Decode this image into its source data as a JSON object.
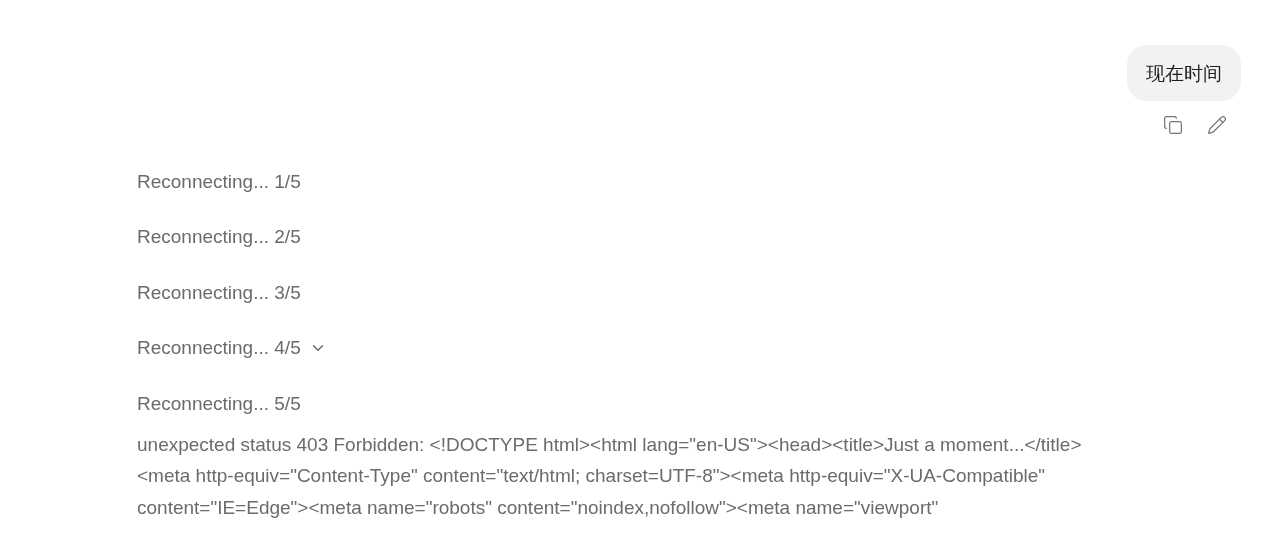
{
  "user_message": {
    "text": "现在时间"
  },
  "status_lines": [
    {
      "text": "Reconnecting... 1/5",
      "expandable": false
    },
    {
      "text": "Reconnecting... 2/5",
      "expandable": false
    },
    {
      "text": "Reconnecting... 3/5",
      "expandable": false
    },
    {
      "text": "Reconnecting... 4/5",
      "expandable": true
    },
    {
      "text": "Reconnecting... 5/5",
      "expandable": false
    }
  ],
  "error_lines": [
    "unexpected status 403 Forbidden: <!DOCTYPE html><html lang=\"en-US\"><head><title>Just a moment...</title>",
    "<meta http-equiv=\"Content-Type\" content=\"text/html; charset=UTF-8\"><meta http-equiv=\"X-UA-Compatible\"",
    "content=\"IE=Edge\"><meta name=\"robots\" content=\"noindex,nofollow\"><meta name=\"viewport\""
  ]
}
